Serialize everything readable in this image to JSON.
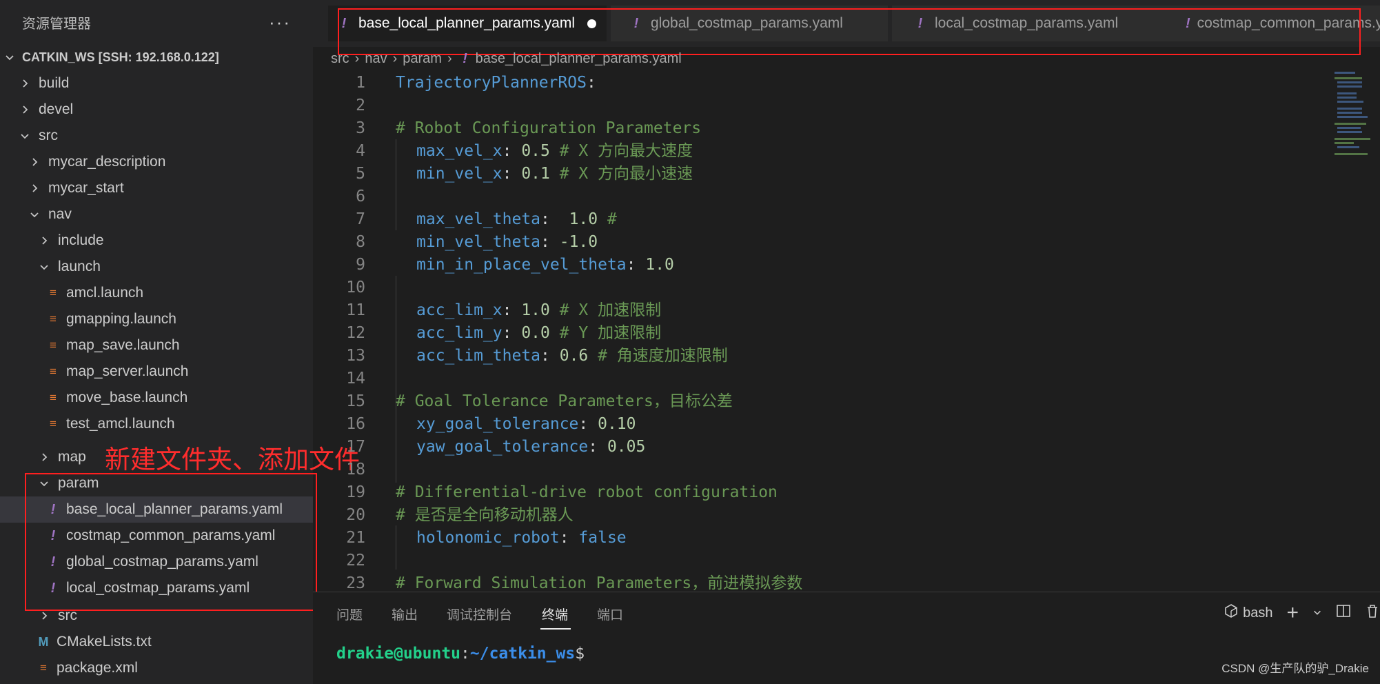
{
  "sidebar": {
    "title": "资源管理器",
    "more": "···",
    "workspace": "CATKIN_WS [SSH: 192.168.0.122]",
    "items": [
      {
        "label": "build"
      },
      {
        "label": "devel"
      },
      {
        "label": "src"
      },
      {
        "label": "mycar_description"
      },
      {
        "label": "mycar_start"
      },
      {
        "label": "nav"
      },
      {
        "label": "include"
      },
      {
        "label": "launch"
      },
      {
        "label": "amcl.launch"
      },
      {
        "label": "gmapping.launch"
      },
      {
        "label": "map_save.launch"
      },
      {
        "label": "map_server.launch"
      },
      {
        "label": "move_base.launch"
      },
      {
        "label": "test_amcl.launch"
      },
      {
        "label": "map"
      },
      {
        "label": "param"
      },
      {
        "label": "base_local_planner_params.yaml"
      },
      {
        "label": "costmap_common_params.yaml"
      },
      {
        "label": "global_costmap_params.yaml"
      },
      {
        "label": "local_costmap_params.yaml"
      },
      {
        "label": "src"
      },
      {
        "label": "CMakeLists.txt"
      },
      {
        "label": "package.xml"
      }
    ]
  },
  "annotation": {
    "text": "新建文件夹、添加文件",
    "color": "#ff2d2d"
  },
  "tabs": [
    {
      "label": "base_local_planner_params.yaml"
    },
    {
      "label": "global_costmap_params.yaml"
    },
    {
      "label": "local_costmap_params.yaml"
    },
    {
      "label": "costmap_common_params.yaml"
    }
  ],
  "breadcrumb": [
    "src",
    "nav",
    "param",
    "base_local_planner_params.yaml"
  ],
  "editor": {
    "lines": [
      {
        "n": "1"
      },
      {
        "n": "2"
      },
      {
        "n": "3"
      },
      {
        "n": "4"
      },
      {
        "n": "5"
      },
      {
        "n": "6"
      },
      {
        "n": "7"
      },
      {
        "n": "8"
      },
      {
        "n": "9"
      },
      {
        "n": "10"
      },
      {
        "n": "11"
      },
      {
        "n": "12"
      },
      {
        "n": "13"
      },
      {
        "n": "14"
      },
      {
        "n": "15"
      },
      {
        "n": "16"
      },
      {
        "n": "17"
      },
      {
        "n": "18"
      },
      {
        "n": "19"
      },
      {
        "n": "20"
      },
      {
        "n": "21"
      },
      {
        "n": "22"
      },
      {
        "n": "23"
      }
    ],
    "code": {
      "l1k": "TrajectoryPlannerROS",
      "l1p": ":",
      "l3c": "# Robot Configuration Parameters",
      "l4k": "max_vel_x",
      "l4p": ": ",
      "l4n": "0.5",
      "l4c": " # X 方向最大速度",
      "l5k": "min_vel_x",
      "l5p": ": ",
      "l5n": "0.1",
      "l5c": " # X 方向最小速速",
      "l7k": "max_vel_theta",
      "l7p": ":  ",
      "l7n": "1.0",
      "l7c": " #",
      "l8k": "min_vel_theta",
      "l8p": ": ",
      "l8n": "-1.0",
      "l9k": "min_in_place_vel_theta",
      "l9p": ": ",
      "l9n": "1.0",
      "l11k": "acc_lim_x",
      "l11p": ": ",
      "l11n": "1.0",
      "l11c": " # X 加速限制",
      "l12k": "acc_lim_y",
      "l12p": ": ",
      "l12n": "0.0",
      "l12c": " # Y 加速限制",
      "l13k": "acc_lim_theta",
      "l13p": ": ",
      "l13n": "0.6",
      "l13c": " # 角速度加速限制",
      "l15c": "# Goal Tolerance Parameters，目标公差",
      "l16k": "xy_goal_tolerance",
      "l16p": ": ",
      "l16n": "0.10",
      "l17k": "yaw_goal_tolerance",
      "l17p": ": ",
      "l17n": "0.05",
      "l19c": "# Differential-drive robot configuration",
      "l20c": "# 是否是全向移动机器人",
      "l21k": "holonomic_robot",
      "l21p": ": ",
      "l21v": "false",
      "l23c": "# Forward Simulation Parameters，前进模拟参数"
    }
  },
  "panel": {
    "tabs": [
      "问题",
      "输出",
      "调试控制台",
      "终端",
      "端口"
    ],
    "active_tab": "终端",
    "shell": "bash",
    "prompt_user": "drakie@ubuntu",
    "prompt_sep": ":",
    "prompt_path": "~/catkin_ws",
    "prompt_end": "$"
  },
  "watermark": "CSDN @生产队的驴_Drakie",
  "colors": {
    "accent_red": "#ff1f1f",
    "yaml_icon": "#a074c4",
    "launch_icon": "#e37933"
  }
}
